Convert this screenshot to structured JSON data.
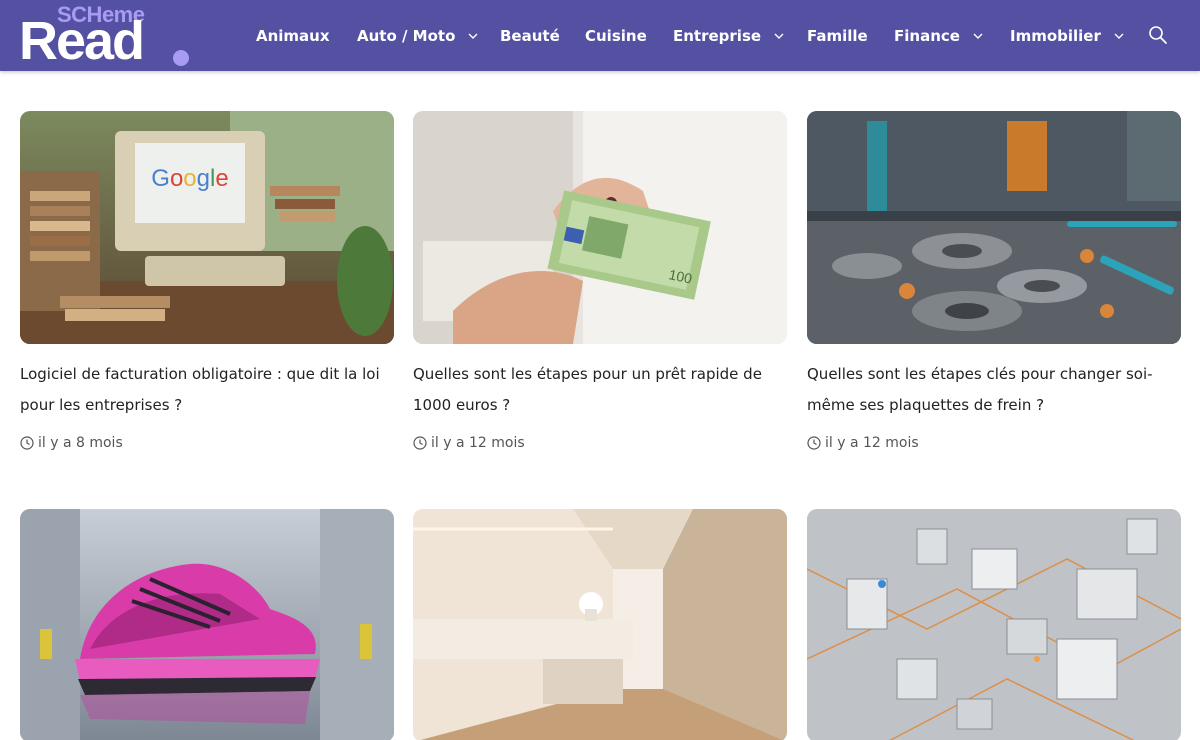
{
  "header": {
    "logo_small": "SCHeme",
    "logo_big": "Read",
    "nav": [
      {
        "label": "Animaux",
        "has_dropdown": false
      },
      {
        "label": "Auto / Moto",
        "has_dropdown": true
      },
      {
        "label": "Beauté",
        "has_dropdown": false
      },
      {
        "label": "Cuisine",
        "has_dropdown": false
      },
      {
        "label": "Entreprise",
        "has_dropdown": true
      },
      {
        "label": "Famille",
        "has_dropdown": false
      },
      {
        "label": "Finance",
        "has_dropdown": true
      },
      {
        "label": "Immobilier",
        "has_dropdown": true
      }
    ],
    "search_icon": "search-icon",
    "chevron_icon": "chevron-down-icon"
  },
  "articles": [
    {
      "title": "Logiciel de facturation obligatoire : que dit la loi pour les entreprises ?",
      "date": "il y a 8 mois",
      "image": "retro computer with Google on screen among books"
    },
    {
      "title": "Quelles sont les étapes pour un prêt rapide de 1000 euros ?",
      "date": "il y a 12 mois",
      "image": "hand handing over a 100 euro banknote"
    },
    {
      "title": "Quelles sont les étapes clés pour changer soi-même ses plaquettes de frein ?",
      "date": "il y a 12 mois",
      "image": "brake discs and tools on a workshop bench"
    },
    {
      "title": "",
      "date": "",
      "image": "pink running shoe"
    },
    {
      "title": "",
      "date": "",
      "image": "beige illuminated hallway"
    },
    {
      "title": "",
      "date": "",
      "image": "isometric circuit city"
    }
  ],
  "colors": {
    "header_bg": "#5551a2",
    "logo_accent": "#a79bf3",
    "text": "#222222",
    "meta": "#555555"
  }
}
